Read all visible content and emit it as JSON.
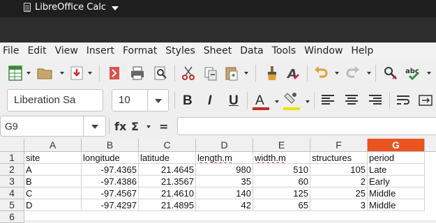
{
  "topbar": {
    "app_name": "LibreOffice Calc"
  },
  "menu": [
    "File",
    "Edit",
    "View",
    "Insert",
    "Format",
    "Styles",
    "Sheet",
    "Data",
    "Tools",
    "Window",
    "Help"
  ],
  "toolbar": {
    "font_name": "Liberation Sa",
    "font_size": "10",
    "bold": "B",
    "italic": "I",
    "underline": "U",
    "font_color_glyph": "A"
  },
  "formula": {
    "cell_ref": "G9",
    "fx": "fx",
    "sigma": "Σ",
    "equals": "=",
    "content": ""
  },
  "columns": [
    "A",
    "B",
    "C",
    "D",
    "E",
    "F",
    "G"
  ],
  "active_column": "G",
  "rows": [
    {
      "num": "1",
      "cells": [
        "site",
        "longitude",
        "latitude",
        "length.m",
        "width.m",
        "structures",
        "period"
      ]
    },
    {
      "num": "2",
      "cells": [
        "A",
        "-97.4365",
        "21.4645",
        "980",
        "510",
        "105",
        "Late"
      ]
    },
    {
      "num": "3",
      "cells": [
        "B",
        "-97.4386",
        "21.3567",
        "35",
        "60",
        "2",
        "Early"
      ]
    },
    {
      "num": "4",
      "cells": [
        "C",
        "-97.4567",
        "21.4610",
        "140",
        "125",
        "25",
        "Middle"
      ]
    },
    {
      "num": "5",
      "cells": [
        "D",
        "-97.4297",
        "21.4895",
        "42",
        "65",
        "3",
        "Middle"
      ]
    },
    {
      "num": "6",
      "cells": [
        "",
        "",
        "",
        "",
        "",
        "",
        ""
      ]
    }
  ],
  "colors": {
    "accent": "#e95420",
    "topbar": "#1e1e1e"
  }
}
